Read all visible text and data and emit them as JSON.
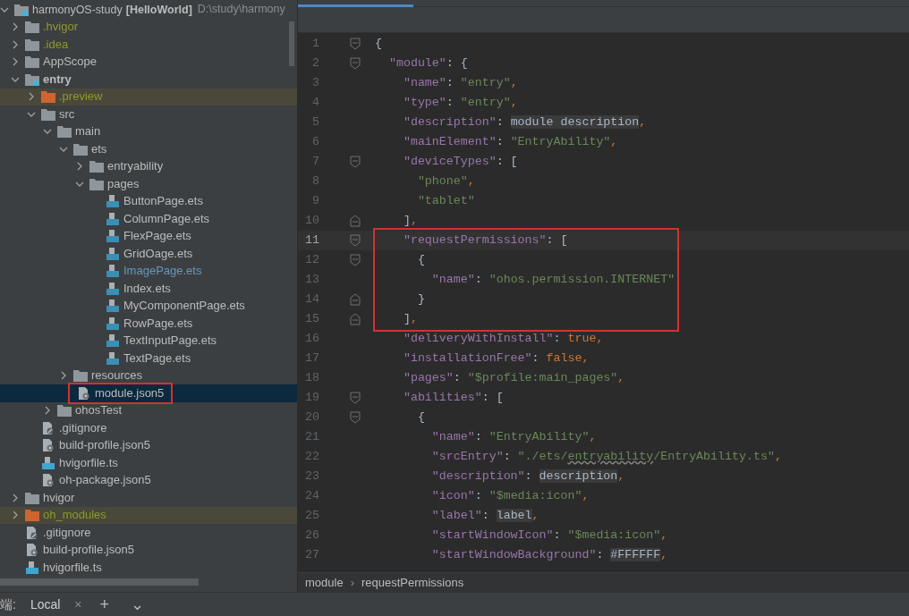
{
  "project_tree": {
    "root": {
      "label": "harmonyOS-study",
      "project": "[HelloWorld]",
      "path": "D:\\study\\harmony",
      "expanded": true
    },
    "items": [
      {
        "label": ".hvigor",
        "kind": "folder",
        "ignored": true,
        "expanded": false,
        "selected": false
      },
      {
        "label": ".idea",
        "kind": "folder",
        "ignored": true,
        "expanded": false,
        "selected": false
      },
      {
        "label": "AppScope",
        "kind": "folder",
        "expanded": false,
        "selected": false
      },
      {
        "label": "entry",
        "kind": "module",
        "bold": true,
        "expanded": true,
        "selected": false,
        "children": [
          {
            "label": ".preview",
            "kind": "excluded",
            "ignored": true,
            "expanded": false,
            "selected": false
          },
          {
            "label": "src",
            "kind": "folder",
            "expanded": true,
            "selected": false,
            "children": [
              {
                "label": "main",
                "kind": "folder",
                "expanded": true,
                "selected": false,
                "children": [
                  {
                    "label": "ets",
                    "kind": "folder",
                    "expanded": true,
                    "selected": false,
                    "children": [
                      {
                        "label": "entryability",
                        "kind": "folder",
                        "expanded": false,
                        "selected": false
                      },
                      {
                        "label": "pages",
                        "kind": "folder",
                        "expanded": true,
                        "selected": false,
                        "children": [
                          {
                            "label": "ButtonPage.ets",
                            "kind": "ets",
                            "selected": false
                          },
                          {
                            "label": "ColumnPage.ets",
                            "kind": "ets",
                            "selected": false
                          },
                          {
                            "label": "FlexPage.ets",
                            "kind": "ets",
                            "selected": false
                          },
                          {
                            "label": "GridOage.ets",
                            "kind": "ets",
                            "selected": false
                          },
                          {
                            "label": "ImagePage.ets",
                            "kind": "ets",
                            "modified": true,
                            "selected": false
                          },
                          {
                            "label": "Index.ets",
                            "kind": "ets",
                            "selected": false
                          },
                          {
                            "label": "MyComponentPage.ets",
                            "kind": "ets",
                            "selected": false
                          },
                          {
                            "label": "RowPage.ets",
                            "kind": "ets",
                            "selected": false
                          },
                          {
                            "label": "TextInputPage.ets",
                            "kind": "ets",
                            "selected": false
                          },
                          {
                            "label": "TextPage.ets",
                            "kind": "ets",
                            "selected": false
                          }
                        ]
                      }
                    ]
                  },
                  {
                    "label": "resources",
                    "kind": "folder",
                    "expanded": false,
                    "selected": false
                  },
                  {
                    "label": "module.json5",
                    "kind": "json",
                    "selected": true,
                    "boxed": true
                  }
                ]
              },
              {
                "label": "ohosTest",
                "kind": "folder",
                "expanded": false,
                "selected": false
              }
            ]
          },
          {
            "label": ".gitignore",
            "kind": "ignore",
            "selected": false
          },
          {
            "label": "build-profile.json5",
            "kind": "json",
            "selected": false
          },
          {
            "label": "hvigorfile.ts",
            "kind": "ts",
            "selected": false
          },
          {
            "label": "oh-package.json5",
            "kind": "json",
            "selected": false
          }
        ]
      },
      {
        "label": "hvigor",
        "kind": "folder",
        "expanded": false,
        "selected": false
      },
      {
        "label": "oh_modules",
        "kind": "excluded",
        "ignored": true,
        "expanded": false,
        "selected": false
      },
      {
        "label": ".gitignore",
        "kind": "ignore",
        "selected": false
      },
      {
        "label": "build-profile.json5",
        "kind": "json",
        "selected": false
      },
      {
        "label": "hvigorfile.ts",
        "kind": "ts",
        "selected": false
      }
    ]
  },
  "editor": {
    "lines": [
      {
        "number": "1",
        "fold_start": true,
        "tokens": [
          {
            "kind": "punct",
            "text": "{"
          }
        ]
      },
      {
        "number": "2",
        "fold_start": true,
        "tokens": [
          {
            "kind": "key",
            "text": "  \"module\""
          },
          {
            "kind": "punct",
            "text": ": {"
          }
        ]
      },
      {
        "number": "3",
        "tokens": [
          {
            "kind": "key",
            "text": "    \"name\""
          },
          {
            "kind": "punct",
            "text": ": "
          },
          {
            "kind": "string",
            "text": "\"entry\""
          },
          {
            "kind": "comma",
            "text": ","
          }
        ]
      },
      {
        "number": "4",
        "tokens": [
          {
            "kind": "key",
            "text": "    \"type\""
          },
          {
            "kind": "punct",
            "text": ": "
          },
          {
            "kind": "string",
            "text": "\"entry\""
          },
          {
            "kind": "comma",
            "text": ","
          }
        ]
      },
      {
        "number": "5",
        "tokens": [
          {
            "kind": "key",
            "text": "    \"description\""
          },
          {
            "kind": "punct",
            "text": ": "
          },
          {
            "kind": "ref",
            "text": "module description"
          },
          {
            "kind": "comma",
            "text": ","
          }
        ]
      },
      {
        "number": "6",
        "tokens": [
          {
            "kind": "key",
            "text": "    \"mainElement\""
          },
          {
            "kind": "punct",
            "text": ": "
          },
          {
            "kind": "string",
            "text": "\"EntryAbility\""
          },
          {
            "kind": "comma",
            "text": ","
          }
        ]
      },
      {
        "number": "7",
        "fold_start": true,
        "tokens": [
          {
            "kind": "key",
            "text": "    \"deviceTypes\""
          },
          {
            "kind": "punct",
            "text": ": ["
          }
        ]
      },
      {
        "number": "8",
        "tokens": [
          {
            "kind": "string",
            "text": "      \"phone\""
          },
          {
            "kind": "comma",
            "text": ","
          }
        ]
      },
      {
        "number": "9",
        "tokens": [
          {
            "kind": "string",
            "text": "      \"tablet\""
          }
        ]
      },
      {
        "number": "10",
        "fold_end": true,
        "tokens": [
          {
            "kind": "punct",
            "text": "    ]"
          },
          {
            "kind": "comma",
            "text": ","
          }
        ]
      },
      {
        "number": "11",
        "fold_start": true,
        "current": true,
        "boxed": true,
        "tokens": [
          {
            "kind": "key",
            "text": "    \"requestPermissions\""
          },
          {
            "kind": "punct",
            "text": ": ["
          }
        ]
      },
      {
        "number": "12",
        "fold_start": true,
        "boxed": true,
        "tokens": [
          {
            "kind": "punct",
            "text": "      {"
          }
        ]
      },
      {
        "number": "13",
        "boxed": true,
        "tokens": [
          {
            "kind": "key",
            "text": "        \"name\""
          },
          {
            "kind": "punct",
            "text": ": "
          },
          {
            "kind": "string",
            "text": "\"ohos.permission.INTERNET\""
          }
        ]
      },
      {
        "number": "14",
        "fold_end": true,
        "boxed": true,
        "tokens": [
          {
            "kind": "punct",
            "text": "      }"
          }
        ]
      },
      {
        "number": "15",
        "fold_end": true,
        "boxed": true,
        "tokens": [
          {
            "kind": "punct",
            "text": "    ]"
          },
          {
            "kind": "comma",
            "text": ","
          }
        ]
      },
      {
        "number": "16",
        "tokens": [
          {
            "kind": "key",
            "text": "    \"deliveryWithInstall\""
          },
          {
            "kind": "punct",
            "text": ": "
          },
          {
            "kind": "comma",
            "text": "true,"
          }
        ]
      },
      {
        "number": "17",
        "tokens": [
          {
            "kind": "key",
            "text": "    \"installationFree\""
          },
          {
            "kind": "punct",
            "text": ": "
          },
          {
            "kind": "comma",
            "text": "false,"
          }
        ]
      },
      {
        "number": "18",
        "tokens": [
          {
            "kind": "key",
            "text": "    \"pages\""
          },
          {
            "kind": "punct",
            "text": ": "
          },
          {
            "kind": "string",
            "text": "\"$profile:main_pages\""
          },
          {
            "kind": "comma",
            "text": ","
          }
        ]
      },
      {
        "number": "19",
        "fold_start": true,
        "tokens": [
          {
            "kind": "key",
            "text": "    \"abilities\""
          },
          {
            "kind": "punct",
            "text": ": ["
          }
        ]
      },
      {
        "number": "20",
        "fold_start": true,
        "tokens": [
          {
            "kind": "punct",
            "text": "      {"
          }
        ]
      },
      {
        "number": "21",
        "tokens": [
          {
            "kind": "key",
            "text": "        \"name\""
          },
          {
            "kind": "punct",
            "text": ": "
          },
          {
            "kind": "string",
            "text": "\"EntryAbility\""
          },
          {
            "kind": "comma",
            "text": ","
          }
        ]
      },
      {
        "number": "22",
        "tokens": [
          {
            "kind": "key",
            "text": "        \"srcEntry\""
          },
          {
            "kind": "punct",
            "text": ": "
          },
          {
            "kind": "string",
            "text": "\"./ets/"
          },
          {
            "kind": "warning",
            "text": "entryability"
          },
          {
            "kind": "string",
            "text": "/EntryAbility.ts\""
          },
          {
            "kind": "comma",
            "text": ","
          }
        ]
      },
      {
        "number": "23",
        "tokens": [
          {
            "kind": "key",
            "text": "        \"description\""
          },
          {
            "kind": "punct",
            "text": ": "
          },
          {
            "kind": "ref",
            "text": "description"
          },
          {
            "kind": "comma",
            "text": ","
          }
        ]
      },
      {
        "number": "24",
        "tokens": [
          {
            "kind": "key",
            "text": "        \"icon\""
          },
          {
            "kind": "punct",
            "text": ": "
          },
          {
            "kind": "string",
            "text": "\"$media:icon\""
          },
          {
            "kind": "comma",
            "text": ","
          }
        ]
      },
      {
        "number": "25",
        "tokens": [
          {
            "kind": "key",
            "text": "        \"label\""
          },
          {
            "kind": "punct",
            "text": ": "
          },
          {
            "kind": "ref",
            "text": "label"
          },
          {
            "kind": "comma",
            "text": ","
          }
        ]
      },
      {
        "number": "26",
        "tokens": [
          {
            "kind": "key",
            "text": "        \"startWindowIcon\""
          },
          {
            "kind": "punct",
            "text": ": "
          },
          {
            "kind": "string",
            "text": "\"$media:icon\""
          },
          {
            "kind": "comma",
            "text": ","
          }
        ]
      },
      {
        "number": "27",
        "tokens": [
          {
            "kind": "key",
            "text": "        \"startWindowBackground\""
          },
          {
            "kind": "punct",
            "text": ": "
          },
          {
            "kind": "ref",
            "text": "#FFFFFF"
          },
          {
            "kind": "comma",
            "text": ","
          }
        ]
      }
    ],
    "breadcrumbs": {
      "items": [
        "module",
        "requestPermissions"
      ],
      "separator": "›"
    }
  },
  "terminal_bar": {
    "label": "端:",
    "tabs": [
      {
        "label": "Local",
        "close": "×",
        "selected": true
      }
    ],
    "add": "+",
    "more": "⌄"
  }
}
